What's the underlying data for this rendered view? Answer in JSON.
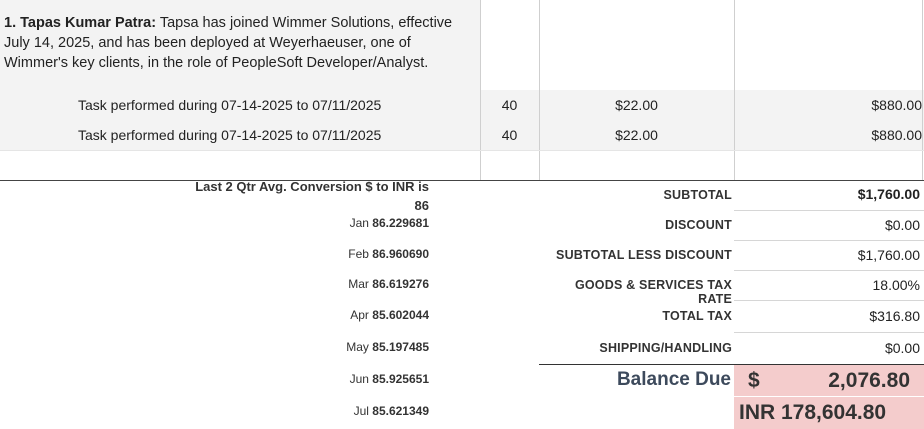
{
  "description": {
    "name": "1. Tapas Kumar Patra:",
    "text": " Tapsa has joined Wimmer Solutions, effective July 14, 2025, and has been deployed at Weyerhaeuser, one of Wimmer's key clients, in the role of PeopleSoft Developer/Analyst."
  },
  "line_items": [
    {
      "task": "Task performed during 07-14-2025 to 07/11/2025",
      "hours": "40",
      "rate": "$22.00",
      "amount": "$880.00"
    },
    {
      "task": "Task performed during 07-14-2025 to 07/11/2025",
      "hours": "40",
      "rate": "$22.00",
      "amount": "$880.00"
    }
  ],
  "conversion": {
    "heading_line1": "Last 2 Qtr Avg. Conversion $ to INR is",
    "heading_line2": "86",
    "months": [
      {
        "month": "Jan",
        "rate": "86.229681"
      },
      {
        "month": "Feb",
        "rate": "86.960690"
      },
      {
        "month": "Mar",
        "rate": "86.619276"
      },
      {
        "month": "Apr",
        "rate": "85.602044"
      },
      {
        "month": "May",
        "rate": "85.197485"
      },
      {
        "month": "Jun",
        "rate": "85.925651"
      },
      {
        "month": "Jul",
        "rate": "85.621349"
      }
    ]
  },
  "totals": {
    "subtotal_label": "SUBTOTAL",
    "subtotal": "$1,760.00",
    "discount_label": "DISCOUNT",
    "discount": "$0.00",
    "subtotal_less_label": "SUBTOTAL LESS DISCOUNT",
    "subtotal_less": "$1,760.00",
    "tax_rate_label": "GOODS & SERVICES TAX RATE",
    "tax_rate": "18.00%",
    "total_tax_label": "TOTAL TAX",
    "total_tax": "$316.80",
    "shipping_label": "SHIPPING/HANDLING",
    "shipping": "$0.00"
  },
  "balance": {
    "label": "Balance Due",
    "currency": "$",
    "amount": "2,076.80",
    "inr": "INR 178,604.80"
  },
  "colors": {
    "highlight": "#f4cccc",
    "row_shade": "#f3f3f3",
    "balance_label": "#3d4a5c"
  }
}
